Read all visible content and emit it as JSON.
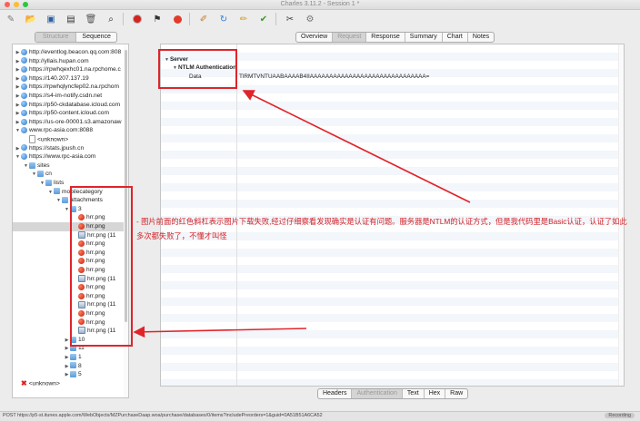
{
  "window": {
    "title": "Charles 3.11.2 - Session 1 *"
  },
  "toolbar": {
    "icons": [
      "new-session-icon",
      "open-icon",
      "save-icon",
      "delete-icon",
      "trash-icon",
      "binoculars-icon",
      "record-icon",
      "throttle-icon",
      "stop-icon",
      "edit-icon",
      "refresh-icon",
      "pencil-icon",
      "check-icon",
      "tools-icon",
      "settings-icon"
    ]
  },
  "view_tabs": {
    "left": [
      "Structure",
      "Sequence"
    ],
    "selected": "Structure"
  },
  "detail_tabs": {
    "items": [
      "Overview",
      "Request",
      "Response",
      "Summary",
      "Chart",
      "Notes"
    ],
    "selected": "Request"
  },
  "bottom_tabs": {
    "items": [
      "Headers",
      "Authentication",
      "Text",
      "Hex",
      "Raw"
    ],
    "selected": "Authentication"
  },
  "tree": [
    {
      "depth": 0,
      "expanded": false,
      "icon": "globe",
      "label": "http://eventlog.beacon.qq.com:808"
    },
    {
      "depth": 0,
      "expanded": false,
      "icon": "globe",
      "label": "http://yllais.hupan.com"
    },
    {
      "depth": 0,
      "expanded": false,
      "icon": "globe",
      "label": "https://rpwhqexhc01.na.rpchome.c"
    },
    {
      "depth": 0,
      "expanded": false,
      "icon": "globe",
      "label": "https://140.207.137.19"
    },
    {
      "depth": 0,
      "expanded": false,
      "icon": "globe",
      "label": "https://rpwhqlyncfep02.na.rpchom"
    },
    {
      "depth": 0,
      "expanded": false,
      "icon": "globe",
      "label": "https://s4-im-notify.csdn.net"
    },
    {
      "depth": 0,
      "expanded": false,
      "icon": "globe",
      "label": "https://p50-ckdatabase.icloud.com"
    },
    {
      "depth": 0,
      "expanded": false,
      "icon": "globe",
      "label": "https://p50-content.icloud.com"
    },
    {
      "depth": 0,
      "expanded": false,
      "icon": "globe",
      "label": "https://us-ore-00001.s3.amazonaw"
    },
    {
      "depth": 0,
      "expanded": true,
      "icon": "globe",
      "label": "www.rpc-asia.com:8088"
    },
    {
      "depth": 1,
      "expanded": null,
      "icon": "doc",
      "label": "<unknown>"
    },
    {
      "depth": 0,
      "expanded": false,
      "icon": "globe",
      "label": "https://stats.jpush.cn"
    },
    {
      "depth": 0,
      "expanded": true,
      "icon": "globe",
      "label": "https://www.rpc-asia.com"
    },
    {
      "depth": 1,
      "expanded": true,
      "icon": "folder",
      "label": "sites"
    },
    {
      "depth": 2,
      "expanded": true,
      "icon": "folder",
      "label": "cn"
    },
    {
      "depth": 3,
      "expanded": true,
      "icon": "folder",
      "label": "lists"
    },
    {
      "depth": 4,
      "expanded": true,
      "icon": "folder",
      "label": "mobilecategory"
    },
    {
      "depth": 5,
      "expanded": true,
      "icon": "folder",
      "label": "attachments"
    },
    {
      "depth": 6,
      "expanded": true,
      "icon": "folder",
      "label": "3"
    },
    {
      "depth": 7,
      "expanded": null,
      "icon": "err",
      "label": "hrr.png"
    },
    {
      "depth": 7,
      "expanded": null,
      "icon": "err",
      "label": "hrr.png",
      "selected": true
    },
    {
      "depth": 7,
      "expanded": null,
      "icon": "img",
      "label": "hrr.png (11"
    },
    {
      "depth": 7,
      "expanded": null,
      "icon": "err",
      "label": "hrr.png"
    },
    {
      "depth": 7,
      "expanded": null,
      "icon": "err",
      "label": "hrr.png"
    },
    {
      "depth": 7,
      "expanded": null,
      "icon": "err",
      "label": "hrr.png"
    },
    {
      "depth": 7,
      "expanded": null,
      "icon": "err",
      "label": "hrr.png"
    },
    {
      "depth": 7,
      "expanded": null,
      "icon": "img",
      "label": "hrr.png (11"
    },
    {
      "depth": 7,
      "expanded": null,
      "icon": "err",
      "label": "hrr.png"
    },
    {
      "depth": 7,
      "expanded": null,
      "icon": "err",
      "label": "hrr.png"
    },
    {
      "depth": 7,
      "expanded": null,
      "icon": "img",
      "label": "hrr.png (11"
    },
    {
      "depth": 7,
      "expanded": null,
      "icon": "err",
      "label": "hrr.png"
    },
    {
      "depth": 7,
      "expanded": null,
      "icon": "err",
      "label": "hrr.png"
    },
    {
      "depth": 7,
      "expanded": null,
      "icon": "img",
      "label": "hrr.png (11"
    },
    {
      "depth": 6,
      "expanded": false,
      "icon": "folder",
      "label": "10"
    },
    {
      "depth": 6,
      "expanded": false,
      "icon": "folder",
      "label": "11"
    },
    {
      "depth": 6,
      "expanded": false,
      "icon": "folder",
      "label": "1"
    },
    {
      "depth": 6,
      "expanded": false,
      "icon": "folder",
      "label": "8"
    },
    {
      "depth": 6,
      "expanded": false,
      "icon": "folder",
      "label": "5"
    },
    {
      "depth": 0,
      "expanded": null,
      "icon": "x",
      "label": "<unknown>"
    }
  ],
  "auth_detail": {
    "server_label": "Server",
    "scheme_label": "NTLM Authentication",
    "data_label": "Data",
    "data_value": "TlRMTVNTUAABAAAAB4IIAAAAAAAAAAAAAAAAAAAAAAAAAAAAAA="
  },
  "annotation": {
    "text": "- 图片前面的红色斜杠表示图片下载失败,经过仔细察看发现确实是认证有问题。服务器是NTLM的认证方式，但是我代码里是Basic认证，认证了如此多次都失败了，不懂才叫怪"
  },
  "statusbar": {
    "url": "POST https://p5-st.itunes.apple.com/WebObjects/MZPurchaseDaap.woa/purchase/databases/0/items?includePreorders=1&guid=0A51B51A6CA52",
    "recording": "Recording"
  },
  "colors": {
    "annotation_red": "#e0242a"
  }
}
